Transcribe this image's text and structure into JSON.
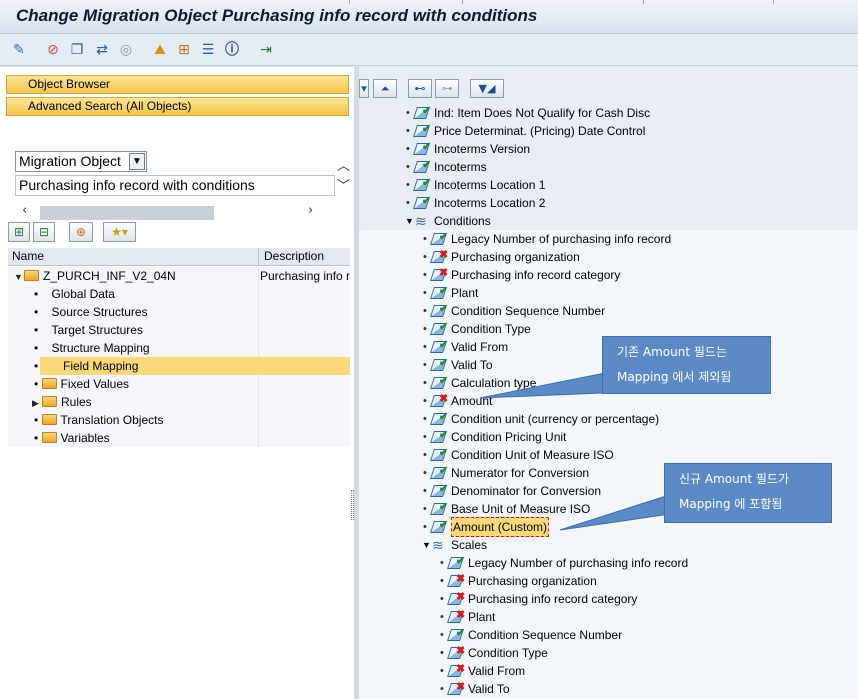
{
  "window_title": "Change Migration Object Purchasing info record with conditions",
  "toolbar_icons": [
    "display-change-icon",
    "stop-icon",
    "copy-icon",
    "translate-icon",
    "target-icon",
    "landscape-icon",
    "hierarchy-icon",
    "list-icon",
    "info-icon",
    "export-icon"
  ],
  "left": {
    "object_browser": "Object Browser",
    "advanced_search": "Advanced Search (All Objects)",
    "selector_value": "Migration Object",
    "search_value": "Purchasing info record with conditions",
    "tree": {
      "col_name": "Name",
      "col_description": "Description",
      "root_name": "Z_PURCH_INF_V2_04N",
      "root_description": "Purchasing info r",
      "children": [
        {
          "label": "Global Data"
        },
        {
          "label": "Source Structures"
        },
        {
          "label": "Target Structures"
        },
        {
          "label": "Structure Mapping"
        },
        {
          "label": "Field Mapping"
        },
        {
          "label": "Fixed Values"
        },
        {
          "label": "Rules"
        },
        {
          "label": "Translation Objects"
        },
        {
          "label": "Variables"
        }
      ]
    }
  },
  "right": {
    "fields_top": [
      "Ind: Item Does Not Qualify for Cash Disc",
      "Price Determinat. (Pricing) Date Control",
      "Incoterms Version",
      "Incoterms",
      "Incoterms Location 1",
      "Incoterms Location 2"
    ],
    "conditions_label": "Conditions",
    "conditions": [
      {
        "label": "Legacy Number of purchasing info record",
        "status": "ok"
      },
      {
        "label": "Purchasing organization",
        "status": "no"
      },
      {
        "label": "Purchasing info record category",
        "status": "no"
      },
      {
        "label": "Plant",
        "status": "ok"
      },
      {
        "label": "Condition Sequence Number",
        "status": "ok"
      },
      {
        "label": "Condition Type",
        "status": "ok"
      },
      {
        "label": "Valid From",
        "status": "ok"
      },
      {
        "label": "Valid To",
        "status": "ok"
      },
      {
        "label": "Calculation type",
        "status": "ok"
      },
      {
        "label": "Amount",
        "status": "no"
      },
      {
        "label": "Condition unit (currency or percentage)",
        "status": "ok"
      },
      {
        "label": "Condition Pricing Unit",
        "status": "ok"
      },
      {
        "label": "Condition Unit of Measure ISO",
        "status": "ok"
      },
      {
        "label": "Numerator for Conversion",
        "status": "ok"
      },
      {
        "label": "Denominator for Conversion",
        "status": "ok"
      },
      {
        "label": "Base Unit of Measure ISO",
        "status": "ok"
      },
      {
        "label": "Amount (Custom)",
        "status": "ok"
      }
    ],
    "scales_label": "Scales",
    "scales": [
      {
        "label": "Legacy Number of purchasing info record",
        "status": "ok"
      },
      {
        "label": "Purchasing organization",
        "status": "no"
      },
      {
        "label": "Purchasing info record category",
        "status": "no"
      },
      {
        "label": "Plant",
        "status": "no"
      },
      {
        "label": "Condition Sequence Number",
        "status": "ok"
      },
      {
        "label": "Condition Type",
        "status": "no"
      },
      {
        "label": "Valid From",
        "status": "no"
      },
      {
        "label": "Valid To",
        "status": "no"
      }
    ]
  },
  "callouts": {
    "excluded_line1": "기존 Amount 필드는",
    "excluded_line2": "Mapping 에서 제외됨",
    "included_line1": "신규  Amount 필드가",
    "included_line2": "Mapping 에 포함됨"
  }
}
